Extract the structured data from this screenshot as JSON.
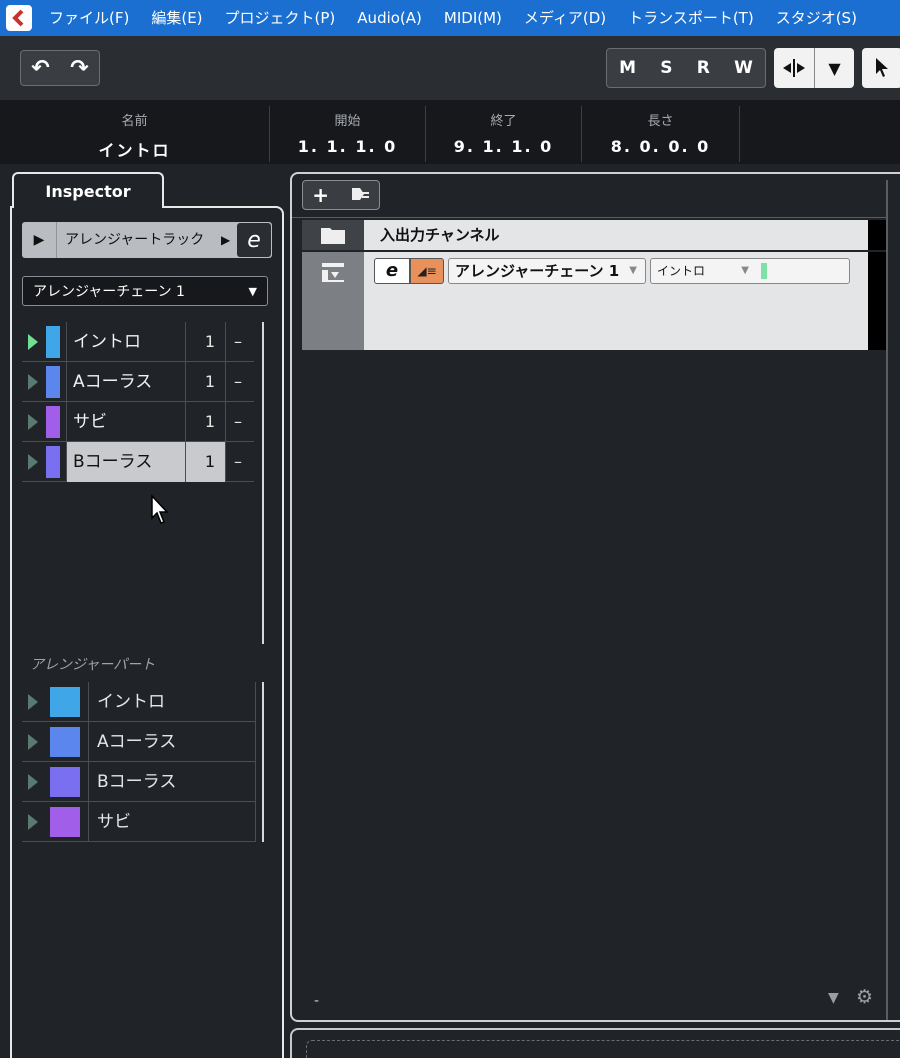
{
  "menubar": {
    "items": [
      "ファイル(F)",
      "編集(E)",
      "プロジェクト(P)",
      "Audio(A)",
      "MIDI(M)",
      "メディア(D)",
      "トランスポート(T)",
      "スタジオ(S)"
    ],
    "logo_color": "#c8322f"
  },
  "toolbar": {
    "undo_icon": "undo-icon",
    "redo_icon": "redo-icon",
    "m": "M",
    "s": "S",
    "r": "R",
    "w": "W",
    "split_icon": "range-split-icon",
    "dropdown_icon": "chevron-down-icon",
    "pointer_icon": "pointer-icon"
  },
  "infoline": {
    "name_label": "名前",
    "name_value": "イントロ",
    "start_label": "開始",
    "start_value": "1. 1. 1.   0",
    "end_label": "終了",
    "end_value": "9. 1. 1.   0",
    "length_label": "長さ",
    "length_value": "8. 0. 0.   0"
  },
  "inspector": {
    "tab": "Inspector",
    "track_name": "アレンジャートラック",
    "edit_glyph": "e",
    "chain": "アレンジャーチェーン 1",
    "chain_rows": [
      {
        "name": "イントロ",
        "count": "1",
        "dash": "–",
        "color": "#3fa7e8",
        "active": true
      },
      {
        "name": "Aコーラス",
        "count": "1",
        "dash": "–",
        "color": "#5b86ee",
        "active": false
      },
      {
        "name": "サビ",
        "count": "1",
        "dash": "–",
        "color": "#a15ee8",
        "active": false
      },
      {
        "name": "Bコーラス",
        "count": "1",
        "dash": "–",
        "color": "#7a6ff0",
        "active": false,
        "selected": true
      }
    ],
    "parts_label": "アレンジャーパート",
    "parts": [
      {
        "name": "イントロ",
        "color": "#3fa7e8"
      },
      {
        "name": "Aコーラス",
        "color": "#5b86ee"
      },
      {
        "name": "Bコーラス",
        "color": "#7a6ff0"
      },
      {
        "name": "サビ",
        "color": "#a15ee8"
      }
    ]
  },
  "project": {
    "add_icon": "plus-icon",
    "add_track_icon": "add-track-icon",
    "folder_track": "入出力チャンネル",
    "arranger_row": {
      "edit_glyph": "e",
      "mode_icon": "arranger-mode-icon",
      "chain": "アレンジャーチェーン 1",
      "part": "イントロ",
      "part_color": "#7de1a8"
    },
    "status_dash": "-",
    "settings_icon": "gear-icon"
  }
}
